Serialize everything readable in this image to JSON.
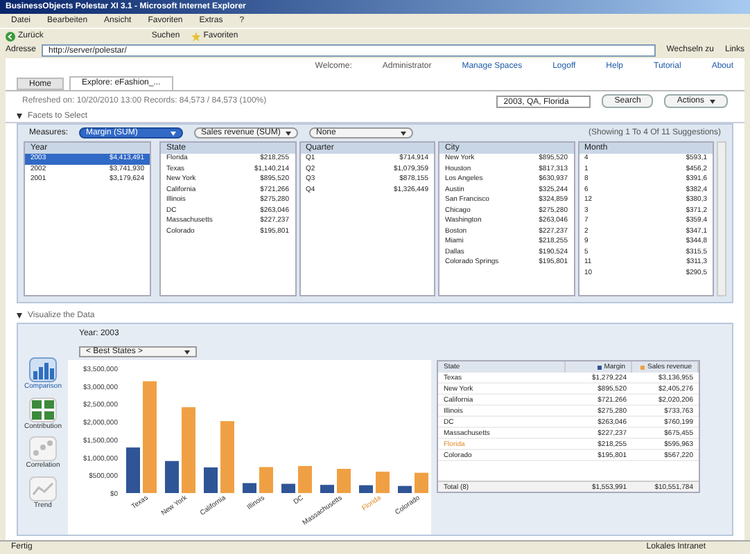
{
  "window": {
    "title": "BusinessObjects Polestar XI 3.1 - Microsoft Internet Explorer"
  },
  "menu": [
    "Datei",
    "Bearbeiten",
    "Ansicht",
    "Favoriten",
    "Extras",
    "?"
  ],
  "toolbar": {
    "back": "Zurück",
    "search": "Suchen",
    "favorites": "Favoriten"
  },
  "address": {
    "label": "Adresse",
    "value": "http://server/polestar/",
    "go": "Wechseln zu",
    "links": "Links"
  },
  "header_links": [
    "Welcome:",
    "Administrator",
    "Manage Spaces",
    "Logoff",
    "Help",
    "Tutorial",
    "About"
  ],
  "tabs": [
    {
      "label": "Home",
      "selected": false
    },
    {
      "label": "Explore: eFashion_...",
      "selected": true
    }
  ],
  "info": "Refreshed on: 10/20/2010 13:00   Records: 84,573 / 84,573 (100%)",
  "search": {
    "value": "2003, QA, Florida",
    "button": "Search",
    "actions": "Actions"
  },
  "facets_title": "Facets to Select",
  "measures": {
    "label": "Measures:",
    "selects": [
      {
        "value": "Margin (SUM)",
        "selected": true
      },
      {
        "value": "Sales revenue (SUM)",
        "selected": false
      },
      {
        "value": "None",
        "selected": false
      }
    ],
    "suggestions": "(Showing 1 To 4 Of 11 Suggestions)"
  },
  "facets": [
    {
      "title": "Year",
      "rows": [
        {
          "label": "2003",
          "value": "$4,413,491",
          "selected": true
        },
        {
          "label": "2002",
          "value": "$3,741,930",
          "selected": false
        },
        {
          "label": "2001",
          "value": "$3,179,624",
          "selected": false
        }
      ]
    },
    {
      "title": "State",
      "rows": [
        {
          "label": "Florida",
          "value": "$218,255",
          "selected": false
        },
        {
          "label": "Texas",
          "value": "$1,140,214",
          "selected": false
        },
        {
          "label": "New York",
          "value": "$895,520",
          "selected": false
        },
        {
          "label": "California",
          "value": "$721,266",
          "selected": false
        },
        {
          "label": "Illinois",
          "value": "$275,280",
          "selected": false
        },
        {
          "label": "DC",
          "value": "$263,046",
          "selected": false
        },
        {
          "label": "Massachusetts",
          "value": "$227,237",
          "selected": false
        },
        {
          "label": "Colorado",
          "value": "$195,801",
          "selected": false
        }
      ]
    },
    {
      "title": "Quarter",
      "rows": [
        {
          "label": "Q1",
          "value": "$714,914",
          "selected": false
        },
        {
          "label": "Q2",
          "value": "$1,079,359",
          "selected": false
        },
        {
          "label": "Q3",
          "value": "$878,155",
          "selected": false
        },
        {
          "label": "Q4",
          "value": "$1,326,449",
          "selected": false
        }
      ]
    },
    {
      "title": "City",
      "rows": [
        {
          "label": "New York",
          "value": "$895,520",
          "selected": false
        },
        {
          "label": "Houston",
          "value": "$817,313",
          "selected": false
        },
        {
          "label": "Los Angeles",
          "value": "$630,937",
          "selected": false
        },
        {
          "label": "Austin",
          "value": "$325,244",
          "selected": false
        },
        {
          "label": "San Francisco",
          "value": "$324,859",
          "selected": false
        },
        {
          "label": "Chicago",
          "value": "$275,280",
          "selected": false
        },
        {
          "label": "Washington",
          "value": "$263,046",
          "selected": false
        },
        {
          "label": "Boston",
          "value": "$227,237",
          "selected": false
        },
        {
          "label": "Miami",
          "value": "$218,255",
          "selected": false
        },
        {
          "label": "Dallas",
          "value": "$190,524",
          "selected": false
        },
        {
          "label": "Colorado Springs",
          "value": "$195,801",
          "selected": false
        }
      ]
    },
    {
      "title": "Month",
      "rows": [
        {
          "label": "4",
          "value": "$593,1",
          "selected": false
        },
        {
          "label": "1",
          "value": "$456,2",
          "selected": false
        },
        {
          "label": "8",
          "value": "$391,6",
          "selected": false
        },
        {
          "label": "6",
          "value": "$382,4",
          "selected": false
        },
        {
          "label": "12",
          "value": "$380,3",
          "selected": false
        },
        {
          "label": "3",
          "value": "$371,2",
          "selected": false
        },
        {
          "label": "7",
          "value": "$359,4",
          "selected": false
        },
        {
          "label": "2",
          "value": "$347,1",
          "selected": false
        },
        {
          "label": "9",
          "value": "$344,8",
          "selected": false
        },
        {
          "label": "5",
          "value": "$315,5",
          "selected": false
        },
        {
          "label": "11",
          "value": "$311,3",
          "selected": false
        },
        {
          "label": "10",
          "value": "$290,5",
          "selected": false
        }
      ]
    }
  ],
  "visualize_title": "Visualize the Data",
  "chart_types": [
    {
      "label": "Comparison",
      "kind": "bar",
      "selected": true
    },
    {
      "label": "Contribution",
      "kind": "grid",
      "selected": false
    },
    {
      "label": "Correlation",
      "kind": "scatter",
      "selected": false
    },
    {
      "label": "Trend",
      "kind": "line",
      "selected": false
    }
  ],
  "year_label": "Year: 2003",
  "ranking": "< Best States >",
  "chart_data": {
    "type": "bar",
    "categories": [
      "Texas",
      "New York",
      "California",
      "Illinois",
      "DC",
      "Massachusetts",
      "Florida",
      "Colorado"
    ],
    "series": [
      {
        "name": "Margin",
        "color": "#2f5597",
        "values": [
          1280000,
          900000,
          720000,
          280000,
          260000,
          230000,
          220000,
          200000
        ]
      },
      {
        "name": "Sales revenue",
        "color": "#f0a044",
        "values": [
          3140000,
          2410000,
          2020000,
          730000,
          760000,
          680000,
          600000,
          570000
        ]
      }
    ],
    "ylim": [
      0,
      3500000
    ],
    "yticks": [
      {
        "value": 0,
        "label": "$0"
      },
      {
        "value": 500000,
        "label": "$500,000"
      },
      {
        "value": 1000000,
        "label": "$1,000,000"
      },
      {
        "value": 1500000,
        "label": "$1,500,000"
      },
      {
        "value": 2000000,
        "label": "$2,000,000"
      },
      {
        "value": 2500000,
        "label": "$2,500,000"
      },
      {
        "value": 3000000,
        "label": "$3,000,000"
      },
      {
        "value": 3500000,
        "label": "$3,500,000"
      }
    ]
  },
  "table": {
    "columns": [
      "State"
    ],
    "rows": [
      {
        "cells": [
          "Texas",
          "$1,279,224",
          "$3,136,955"
        ],
        "highlighted": false
      },
      {
        "cells": [
          "New York",
          "$895,520",
          "$2,405,276"
        ],
        "highlighted": false
      },
      {
        "cells": [
          "California",
          "$721,266",
          "$2,020,206"
        ],
        "highlighted": false
      },
      {
        "cells": [
          "Illinois",
          "$275,280",
          "$733,763"
        ],
        "highlighted": false
      },
      {
        "cells": [
          "DC",
          "$263,046",
          "$760,199"
        ],
        "highlighted": false
      },
      {
        "cells": [
          "Massachusetts",
          "$227,237",
          "$675,455"
        ],
        "highlighted": false
      },
      {
        "cells": [
          "Florida",
          "$218,255",
          "$595,963"
        ],
        "highlighted": true
      },
      {
        "cells": [
          "Colorado",
          "$195,801",
          "$567,220"
        ],
        "highlighted": false
      }
    ],
    "total": [
      "Total (8)",
      "$1,553,991",
      "$10,551,784"
    ]
  },
  "status_bar": {
    "text": "Fertig",
    "zone": "Lokales Intranet"
  }
}
